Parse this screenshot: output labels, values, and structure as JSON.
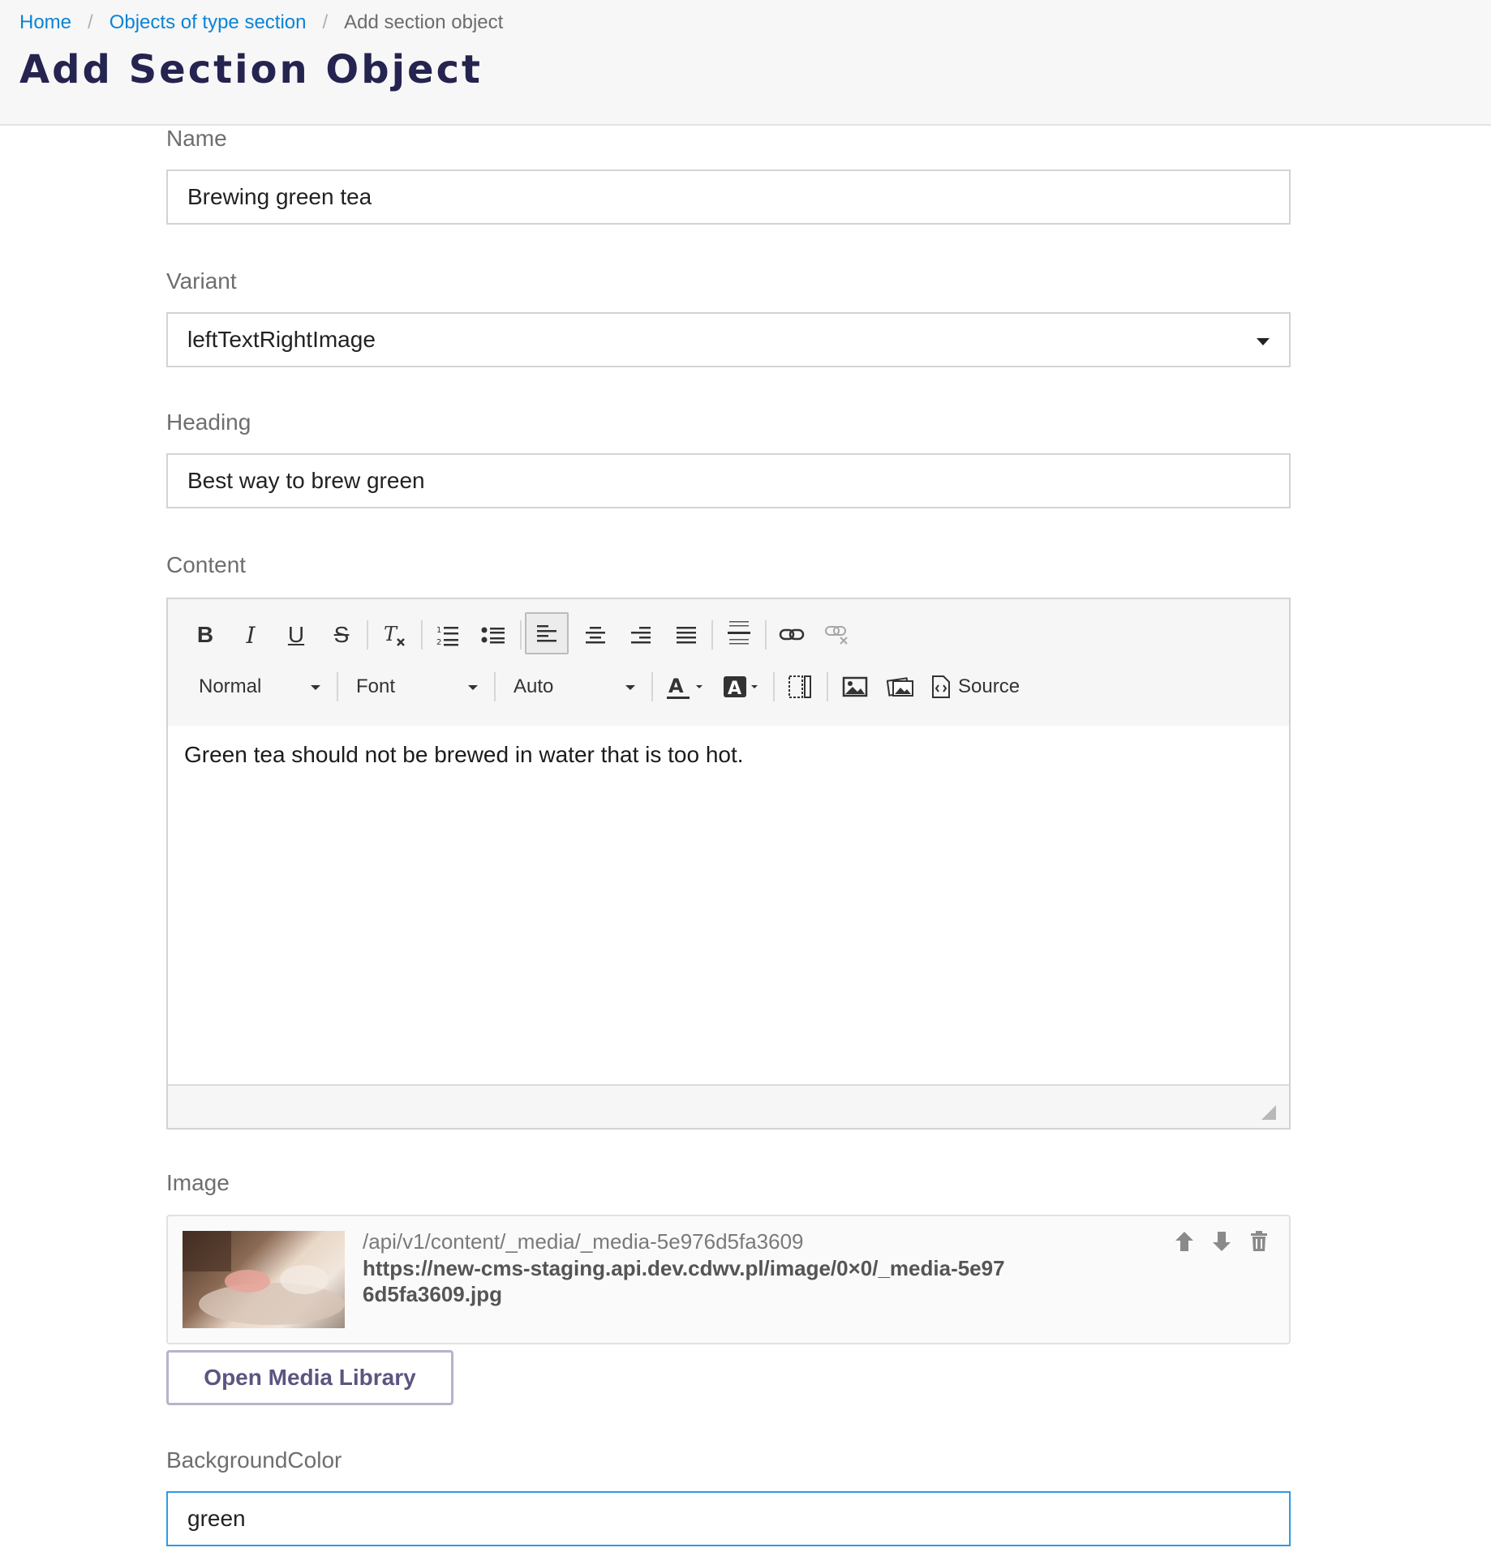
{
  "breadcrumb": {
    "home": "Home",
    "objects": "Objects of type section",
    "current": "Add section object",
    "separator": "/"
  },
  "page": {
    "title": "Add Section Object"
  },
  "form": {
    "name": {
      "label": "Name",
      "value": "Brewing green tea"
    },
    "variant": {
      "label": "Variant",
      "value": "leftTextRightImage"
    },
    "heading": {
      "label": "Heading",
      "value": "Best way to brew green"
    },
    "content": {
      "label": "Content",
      "toolbar": {
        "format": "Normal",
        "font": "Font",
        "size": "Auto",
        "source": "Source",
        "bold": "B",
        "italic": "I",
        "underline": "U",
        "strike": "S"
      },
      "body": "Green tea should not be brewed in water that is too hot."
    },
    "image": {
      "label": "Image",
      "path": "/api/v1/content/_media/_media-5e976d5fa3609",
      "url": "https://new-cms-staging.api.dev.cdwv.pl/image/0×0/_media-5e976d5fa3609.jpg",
      "open_library": "Open Media Library"
    },
    "background": {
      "label": "BackgroundColor",
      "value": "green"
    }
  },
  "colors": {
    "link": "#0a84d6",
    "title": "#25234f",
    "focus": "#2d9be6"
  }
}
